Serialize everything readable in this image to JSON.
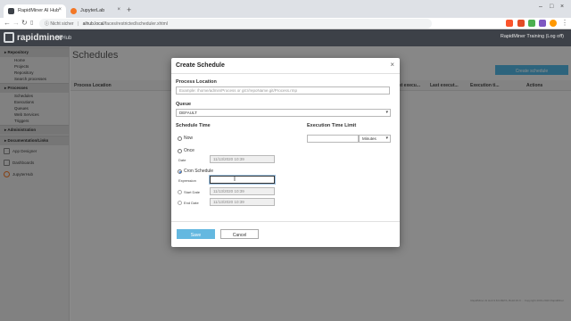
{
  "browser": {
    "tabs": [
      {
        "title": "RapidMiner AI Hub",
        "active": true,
        "favicon_color": "#3d4148"
      },
      {
        "title": "JupyterLab",
        "active": false,
        "favicon_color": "#f37726"
      }
    ],
    "new_tab": "+",
    "address": {
      "security": "Nicht sicher",
      "host": "aihub.local",
      "path": "/faces/restricted/scheduler.xhtml"
    }
  },
  "app": {
    "logo": "rapidminer",
    "logo_sub": "AI Hub",
    "user": "RapidMiner Training (Log off)"
  },
  "sidebar": {
    "sections": [
      {
        "title": "Repository",
        "items": [
          "Home",
          "Projects",
          "Repository",
          "Search processes"
        ]
      },
      {
        "title": "Processes",
        "items": [
          "Schedules",
          "Executions",
          "Queues",
          "Web Services",
          "Triggers"
        ]
      },
      {
        "title": "Administration",
        "items": []
      },
      {
        "title": "Documentation/Links",
        "items": []
      }
    ],
    "apps": [
      {
        "label": "App Designer",
        "icon": "app-designer-icon"
      },
      {
        "label": "Dashboards",
        "icon": "dashboards-icon"
      },
      {
        "label": "JupyterHub",
        "icon": "jupyterhub-icon"
      }
    ]
  },
  "main": {
    "title": "Schedules",
    "create_button": "Create schedule",
    "columns": [
      "Process Location",
      "Last execu...",
      "Last execut...",
      "Execution ti...",
      "Actions"
    ],
    "footer": "RapidMiner AI Hub 9.8.0-BETA, Build #4.9 ... Copyright 2001-2020 RapidMiner"
  },
  "modal": {
    "title": "Create Schedule",
    "close": "×",
    "process_location": {
      "label": "Process Location",
      "placeholder": "Example: /home/admin/Process or git://repoName.git/Process.rmp"
    },
    "queue": {
      "label": "Queue",
      "value": "DEFAULT"
    },
    "schedule_time": {
      "label": "Schedule Time",
      "options": {
        "now": "Now",
        "once": "Once",
        "date_label": "Date",
        "date_value": "11/13/2020 10:39",
        "cron": "Cron Schedule",
        "expression_label": "Expression",
        "expression_value": "",
        "start_label": "Start Date",
        "start_value": "11/13/2020 10:39",
        "end_label": "End Date",
        "end_value": "11/13/2020 10:39"
      },
      "selected": "cron"
    },
    "exec_limit": {
      "label": "Execution Time Limit",
      "value": "",
      "unit": "Minutes"
    },
    "save": "Save",
    "cancel": "Cancel"
  },
  "colors": {
    "header": "#3d4148",
    "accent": "#52b7e3",
    "save": "#64b8e0"
  }
}
